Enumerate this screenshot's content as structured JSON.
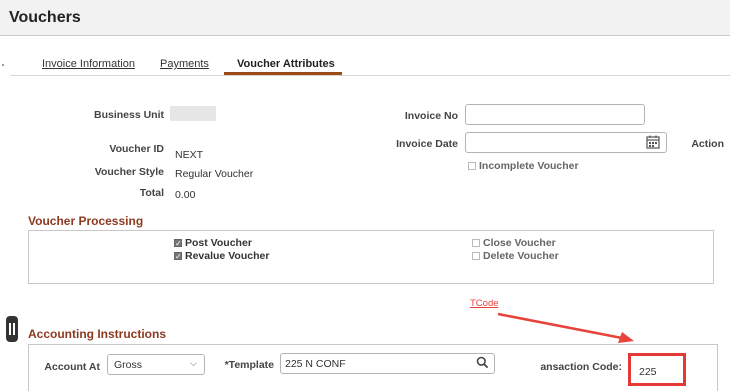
{
  "page": {
    "title": "Vouchers"
  },
  "tabs": [
    "Invoice Information",
    "Payments",
    "Voucher Attributes"
  ],
  "header": {
    "business_unit_label": "Business Unit",
    "voucher_id_label": "Voucher ID",
    "voucher_id_value": "NEXT",
    "voucher_style_label": "Voucher Style",
    "voucher_style_value": "Regular Voucher",
    "total_label": "Total",
    "total_value": "0.00",
    "invoice_no_label": "Invoice No",
    "invoice_date_label": "Invoice Date",
    "action_label": "Action",
    "incomplete_label": "Incomplete Voucher"
  },
  "processing": {
    "title": "Voucher Processing",
    "post": "Post Voucher",
    "revalue": "Revalue Voucher",
    "close": "Close Voucher",
    "delete": "Delete Voucher"
  },
  "accounting": {
    "title": "Accounting Instructions",
    "account_at_label": "Account At",
    "account_at_value": "Gross",
    "template_label": "*Template",
    "template_value": "225 N CONF",
    "transaction_code_label": "ansaction Code:",
    "transaction_code_value": "225"
  },
  "annotation": {
    "label": "TCode",
    "color": "#e8423a"
  }
}
